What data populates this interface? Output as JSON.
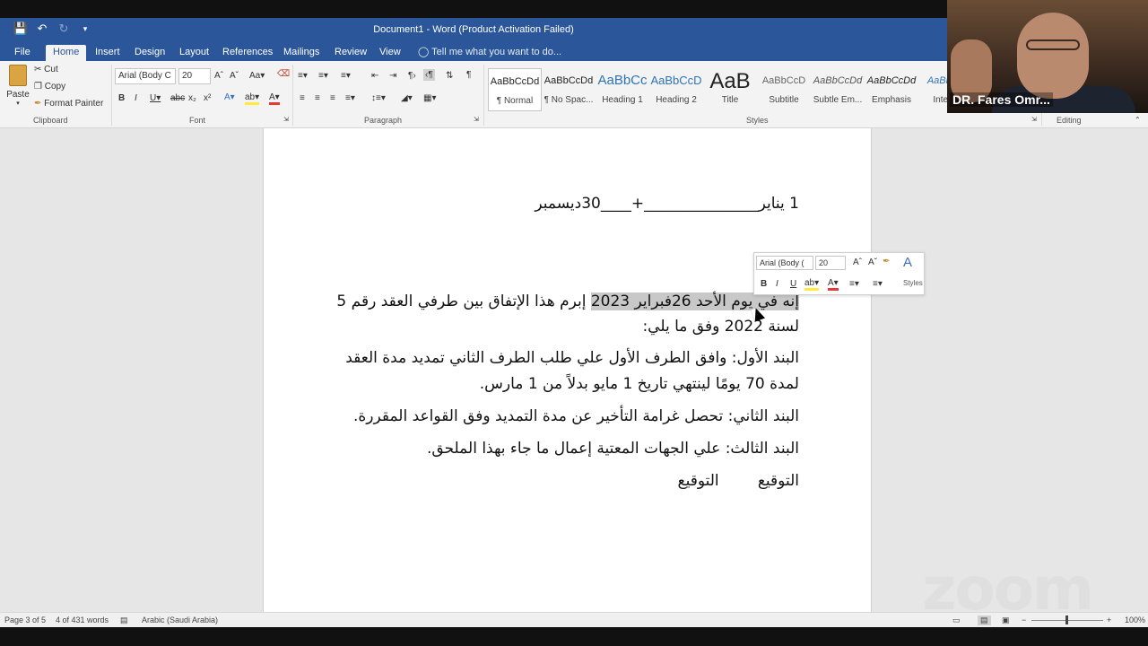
{
  "window": {
    "title": "Document1 - Word (Product Activation Failed)"
  },
  "qat": {
    "save_icon": "save-icon",
    "undo_icon": "undo-icon",
    "redo_icon": "redo-icon",
    "customize_icon": "chevron-down-icon"
  },
  "tabs": [
    {
      "label": "File"
    },
    {
      "label": "Home"
    },
    {
      "label": "Insert"
    },
    {
      "label": "Design"
    },
    {
      "label": "Layout"
    },
    {
      "label": "References"
    },
    {
      "label": "Mailings"
    },
    {
      "label": "Review"
    },
    {
      "label": "View"
    }
  ],
  "tellme": "Tell me what you want to do...",
  "clipboard": {
    "paste": "Paste",
    "cut": "Cut",
    "copy": "Copy",
    "format_painter": "Format Painter",
    "group": "Clipboard"
  },
  "font": {
    "name": "Arial (Body C",
    "size": "20",
    "group": "Font"
  },
  "paragraph": {
    "group": "Paragraph"
  },
  "styles": {
    "group": "Styles",
    "items": [
      {
        "sample": "AaBbCcDd",
        "name": "¶ Normal"
      },
      {
        "sample": "AaBbCcDd",
        "name": "¶ No Spac..."
      },
      {
        "sample": "AaBbCc",
        "name": "Heading 1"
      },
      {
        "sample": "AaBbCcD",
        "name": "Heading 2"
      },
      {
        "sample": "AaB",
        "name": "Title"
      },
      {
        "sample": "AaBbCcD",
        "name": "Subtitle"
      },
      {
        "sample": "AaBbCcDd",
        "name": "Subtle Em..."
      },
      {
        "sample": "AaBbCcDd",
        "name": "Emphasis"
      },
      {
        "sample": "AaBbCc",
        "name": "Intens"
      }
    ]
  },
  "editing": {
    "group": "Editing"
  },
  "document": {
    "line1": "1 يناير_______________+____30ديسمبر",
    "p1_a": "إنه في يوم الأحد 26فبراير 2023",
    "p1_b": " إبرم هذا الإتفاق بين طرفي العقد رقم 5",
    "p1_c": "لسنة 2022 وفق ما يلي:",
    "p2_a": "البند الأول: وافق الطرف الأول علي طلب الطرف الثاني تمديد مدة العقد",
    "p2_b": "لمدة 70 يومًا لينتهي تاريخ 1 مايو بدلاً من 1 مارس.",
    "p3": "البند الثاني: تحصل غرامة التأخير عن مدة التمديد وفق القواعد المقررة.",
    "p4": "البند الثالث: علي الجهات المعتية إعمال ما جاء بهذا الملحق.",
    "p5": "التوقيع        التوقيع"
  },
  "mini_toolbar": {
    "font": "Arial (Body (",
    "size": "20",
    "styles": "Styles"
  },
  "statusbar": {
    "page": "Page 3 of 5",
    "words": "4 of 431 words",
    "language": "Arabic (Saudi Arabia)",
    "zoom": "100%"
  },
  "webcam": {
    "name": "DR. Fares Omr..."
  },
  "watermark": "zoom"
}
